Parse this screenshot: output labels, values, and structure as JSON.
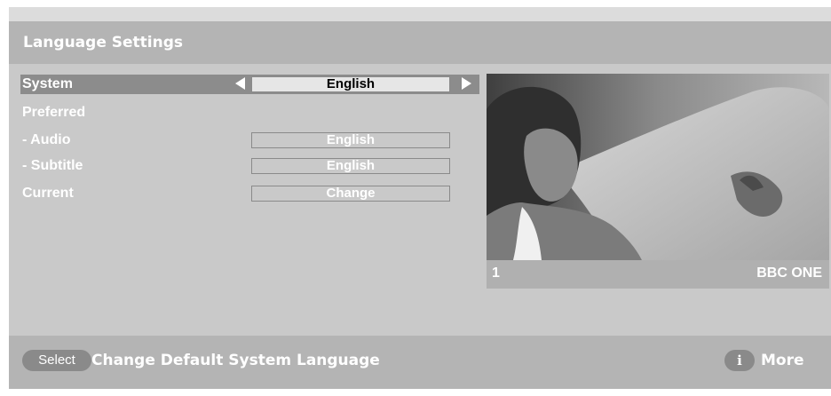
{
  "header": {
    "title": "Language Settings"
  },
  "settings": {
    "system": {
      "label": "System",
      "value": "English"
    },
    "preferred": {
      "label": "Preferred"
    },
    "audio": {
      "label": " - Audio",
      "value": "English"
    },
    "subtitle": {
      "label": " - Subtitle",
      "value": "English"
    },
    "current": {
      "label": "Current",
      "value": "Change"
    }
  },
  "preview": {
    "channel_number": "1",
    "channel_name": "BBC ONE"
  },
  "footer": {
    "select_button": "Select",
    "select_hint": "Change Default System Language",
    "info_button": "i",
    "more_label": "More"
  },
  "colors": {
    "header_bg": "#b4b4b4",
    "content_bg": "#c9c9c9",
    "selected_row": "#8c8c8c",
    "text": "#ffffff"
  }
}
